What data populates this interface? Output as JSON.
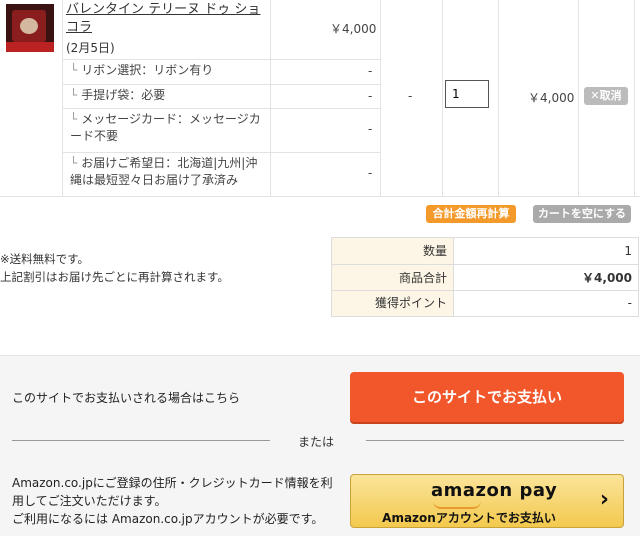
{
  "cart": {
    "product_name": "バレンタイン テリーヌ ドゥ ショコラ",
    "product_date": "(2月5日)",
    "unit_price": "￥4,000",
    "options": [
      {
        "text": "リボン選択：リボン有り",
        "price": "-"
      },
      {
        "text": "手提げ袋：必要",
        "price": "-"
      },
      {
        "text": "メッセージカード：メッセージカード不要",
        "price": "-"
      },
      {
        "text": "お届けご希望日：北海道|九州|沖縄は最短翌々日お届け了承済み",
        "price": "-"
      }
    ],
    "option_dash": "-",
    "quantity": "1",
    "subtotal": "￥4,000",
    "cancel_label": "✕取消"
  },
  "actions": {
    "recalc_label": "合計金額再計算",
    "empty_label": "カートを空にする"
  },
  "notes": {
    "line1": "※送料無料です。",
    "line2": "上記割引はお届け先ごとに再計算されます。"
  },
  "summary": {
    "rows": [
      {
        "label": "数量",
        "value": "1"
      },
      {
        "label": "商品合計",
        "value": "￥4,000"
      },
      {
        "label": "獲得ポイント",
        "value": "-"
      }
    ]
  },
  "payment": {
    "site_text": "このサイトでお支払いされる場合はこちら",
    "site_button": "このサイトでお支払い",
    "or_text": "または",
    "amazon_text_1": "Amazon.co.jpにご登録の住所・クレジットカード情報を利",
    "amazon_text_2": "用してご注文いただけます。",
    "amazon_text_3": "ご利用になるには Amazon.co.jpアカウントが必要です。",
    "amazon_logo": "amazon pay",
    "amazon_button": "Amazonアカウントでお支払い",
    "amazon_chevron": "›"
  }
}
